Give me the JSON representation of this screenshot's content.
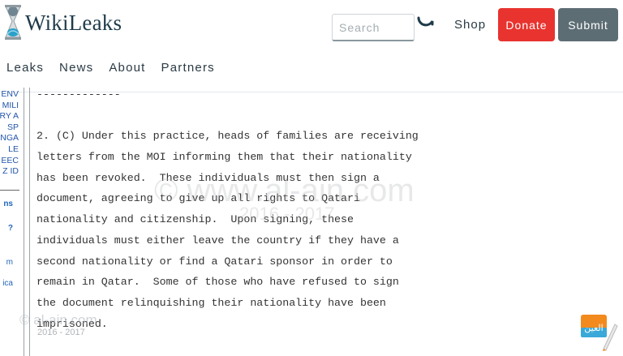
{
  "header": {
    "logo_text": "WikiLeaks",
    "search": {
      "placeholder": "Search",
      "value": ""
    },
    "shop_label": "Shop",
    "donate_label": "Donate",
    "submit_label": "Submit"
  },
  "nav": {
    "items": [
      {
        "label": "Leaks"
      },
      {
        "label": "News"
      },
      {
        "label": "About"
      },
      {
        "label": "Partners"
      }
    ]
  },
  "sidebar": {
    "codes": [
      "ENV",
      "MILI",
      "RY A",
      "SP",
      "NGA",
      "LE",
      "EEC",
      "Z ID"
    ],
    "links": [
      "ns",
      "?",
      "m",
      "ica"
    ]
  },
  "cable": {
    "lines": [
      "-------------",
      "",
      "2. (C) Under this practice, heads of families are receiving",
      "letters from the MOI informing them that their nationality",
      "has been revoked.  These individuals must then sign a",
      "document, agreeing to give up all rights to Qatari",
      "nationality and citizenship.  Upon signing, these",
      "individuals must either leave the country if they have a",
      "second nationality or find a Qatari sponsor in order to",
      "remain in Qatar.  Some of those who have refused to sign",
      "the document relinquishing their nationality have been",
      "imprisoned."
    ]
  },
  "watermark": {
    "main": "© www.al-ain.com",
    "main_years": "2016 - 2017",
    "small": "© al-ain.com",
    "small_years": "2016 - 2017",
    "corner_logo_text": "العين"
  },
  "colors": {
    "donate": "#e8332f",
    "submit": "#5d6d74",
    "link_blue": "#2255aa",
    "logo_text": "#1f3b4a"
  }
}
